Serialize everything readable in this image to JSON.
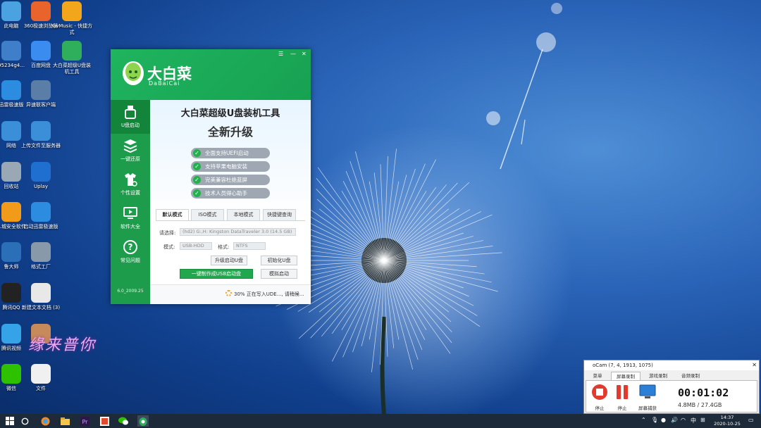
{
  "desktop": {
    "icons": [
      {
        "label": "此电脑",
        "icon": "computer-icon",
        "color": "#4aa3e0"
      },
      {
        "label": "360极速浏览器",
        "icon": "browser-360-icon",
        "color": "#e9632d"
      },
      {
        "label": "KwMusic - 快捷方式",
        "icon": "kwmusic-icon",
        "color": "#f2a61c"
      },
      {
        "label": "95234g4...",
        "icon": "network-drive-icon",
        "color": "#3f7ec9"
      },
      {
        "label": "百度网盘",
        "icon": "baidu-pan-icon",
        "color": "#3b8cf0"
      },
      {
        "label": "大白菜超级U盘装机工具",
        "icon": "dabaicai-icon",
        "color": "#2fae5b"
      },
      {
        "label": "迅雷极速版",
        "icon": "xunlei-icon",
        "color": "#2c8de0"
      },
      {
        "label": "异速联客户端",
        "icon": "remote-client-icon",
        "color": "#5a7ea8"
      },
      {
        "label": "网络",
        "icon": "network-icon",
        "color": "#3b8fd8"
      },
      {
        "label": "上传文件至服务器",
        "icon": "upload-server-icon",
        "color": "#3b8fd8"
      },
      {
        "label": "回收站",
        "icon": "recycle-bin-icon",
        "color": "#9aa7b5"
      },
      {
        "label": "Uplay",
        "icon": "uplay-icon",
        "color": "#1f6fd1"
      },
      {
        "label": "...城安全软件",
        "icon": "security-software-icon",
        "color": "#f29b1a"
      },
      {
        "label": "启动迅雷极速版",
        "icon": "xunlei-start-icon",
        "color": "#2c8de0"
      },
      {
        "label": "鲁大师",
        "icon": "ludashi-icon",
        "color": "#2a6fb8"
      },
      {
        "label": "格式工厂",
        "icon": "format-factory-icon",
        "color": "#8899aa"
      },
      {
        "label": "腾讯QQ",
        "icon": "qq-icon",
        "color": "#222"
      },
      {
        "label": "新建文本文档 (3)",
        "icon": "text-document-icon",
        "color": "#e8e8e8"
      },
      {
        "label": "腾讯视频",
        "icon": "tencent-video-icon",
        "color": "#35a3e8"
      },
      {
        "label": "",
        "icon": "photo-icon",
        "color": "#c78a5a"
      },
      {
        "label": "微信",
        "icon": "wechat-icon",
        "color": "#2dc100"
      },
      {
        "label": "文件",
        "icon": "file-icon",
        "color": "#f0f0f0"
      }
    ],
    "watermark": "缘来普你"
  },
  "dabaicai": {
    "window_controls": {
      "menu": "☰",
      "minimize": "—",
      "close": "✕"
    },
    "logo_title": "大白菜",
    "logo_subtitle": "DaBaiCai",
    "sidebar": [
      {
        "label": "U盘启动",
        "icon": "usb-icon",
        "active": true
      },
      {
        "label": "一键还原",
        "icon": "restore-icon",
        "active": false
      },
      {
        "label": "个性设置",
        "icon": "personalize-icon",
        "active": false
      },
      {
        "label": "软件大全",
        "icon": "software-icon",
        "active": false
      },
      {
        "label": "常见问题",
        "icon": "help-icon",
        "active": false
      }
    ],
    "version": "6.0_2009.25",
    "main_title": "大白菜超级U盘装机工具",
    "main_subtitle": "全新升级",
    "features": [
      "全面支持UEFI启动",
      "支持苹果电脑安装",
      "完美兼容杜绝蓝屏",
      "技术人员得心助手"
    ],
    "tabs": [
      "默认模式",
      "ISO模式",
      "本地模式",
      "快捷键查询"
    ],
    "active_tab": 0,
    "form": {
      "device_label": "请选择:",
      "device_value": "(hd2) G:,H: Kingston DataTraveler 3.0 (14.5 GB)",
      "mode_label": "模式:",
      "mode_value": "USB-HDD",
      "format_label": "格式:",
      "format_value": "NTFS"
    },
    "buttons": {
      "upgrade": "升级启动U盘",
      "init": "初始化U盘",
      "make": "一键制作成USB启动盘",
      "simulate": "模拟启动"
    },
    "status": "30% 正在写入UDE..., 请稍候...",
    "colors": {
      "brand_green": "#1fb45e",
      "sidebar_green": "#1d9c4b"
    }
  },
  "ocam": {
    "title": "oCam (7, 4, 1913, 1075)",
    "tabs": [
      "菜单",
      "屏幕录制",
      "游戏录制",
      "音频录制"
    ],
    "active_tab": 1,
    "buttons": [
      {
        "label": "停止",
        "icon": "record-stop-icon"
      },
      {
        "label": "停止",
        "icon": "pause-icon"
      },
      {
        "label": "屏幕捕获",
        "icon": "screen-capture-icon"
      }
    ],
    "timer": "00:01:02",
    "size": "4.8MB / 27.4GB"
  },
  "taskbar": {
    "apps": [
      "start-icon",
      "search-icon",
      "browser-360-icon",
      "file-explorer-icon",
      "premiere-icon",
      "office-icon",
      "wechat-icon",
      "dabaicai-icon"
    ],
    "tray_ime": "中",
    "time": "14:37",
    "date": "2020-10-25"
  }
}
